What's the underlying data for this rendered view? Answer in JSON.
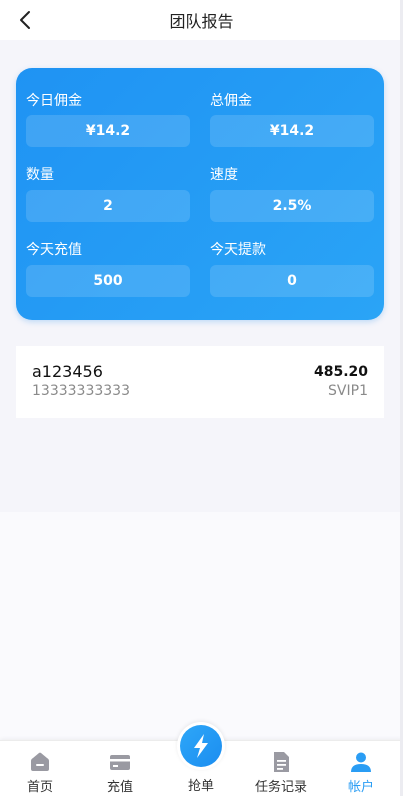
{
  "header": {
    "title": "团队报告"
  },
  "stats": {
    "today_commission": {
      "label": "今日佣金",
      "value": "¥14.2"
    },
    "total_commission": {
      "label": "总佣金",
      "value": "¥14.2"
    },
    "quantity": {
      "label": "数量",
      "value": "2"
    },
    "speed": {
      "label": "速度",
      "value": "2.5%"
    },
    "today_recharge": {
      "label": "今天充值",
      "value": "500"
    },
    "today_withdraw": {
      "label": "今天提款",
      "value": "0"
    }
  },
  "members": [
    {
      "name": "a123456",
      "phone": "13333333333",
      "amount": "485.20",
      "level": "SVIP1"
    }
  ],
  "tabbar": {
    "home": "首页",
    "recharge": "充值",
    "grab": "抢单",
    "records": "任务记录",
    "account": "帐户"
  },
  "colors": {
    "accent": "#2a9df4",
    "card_gradient_start": "#1f93f3",
    "card_gradient_end": "#2aa4f6"
  }
}
